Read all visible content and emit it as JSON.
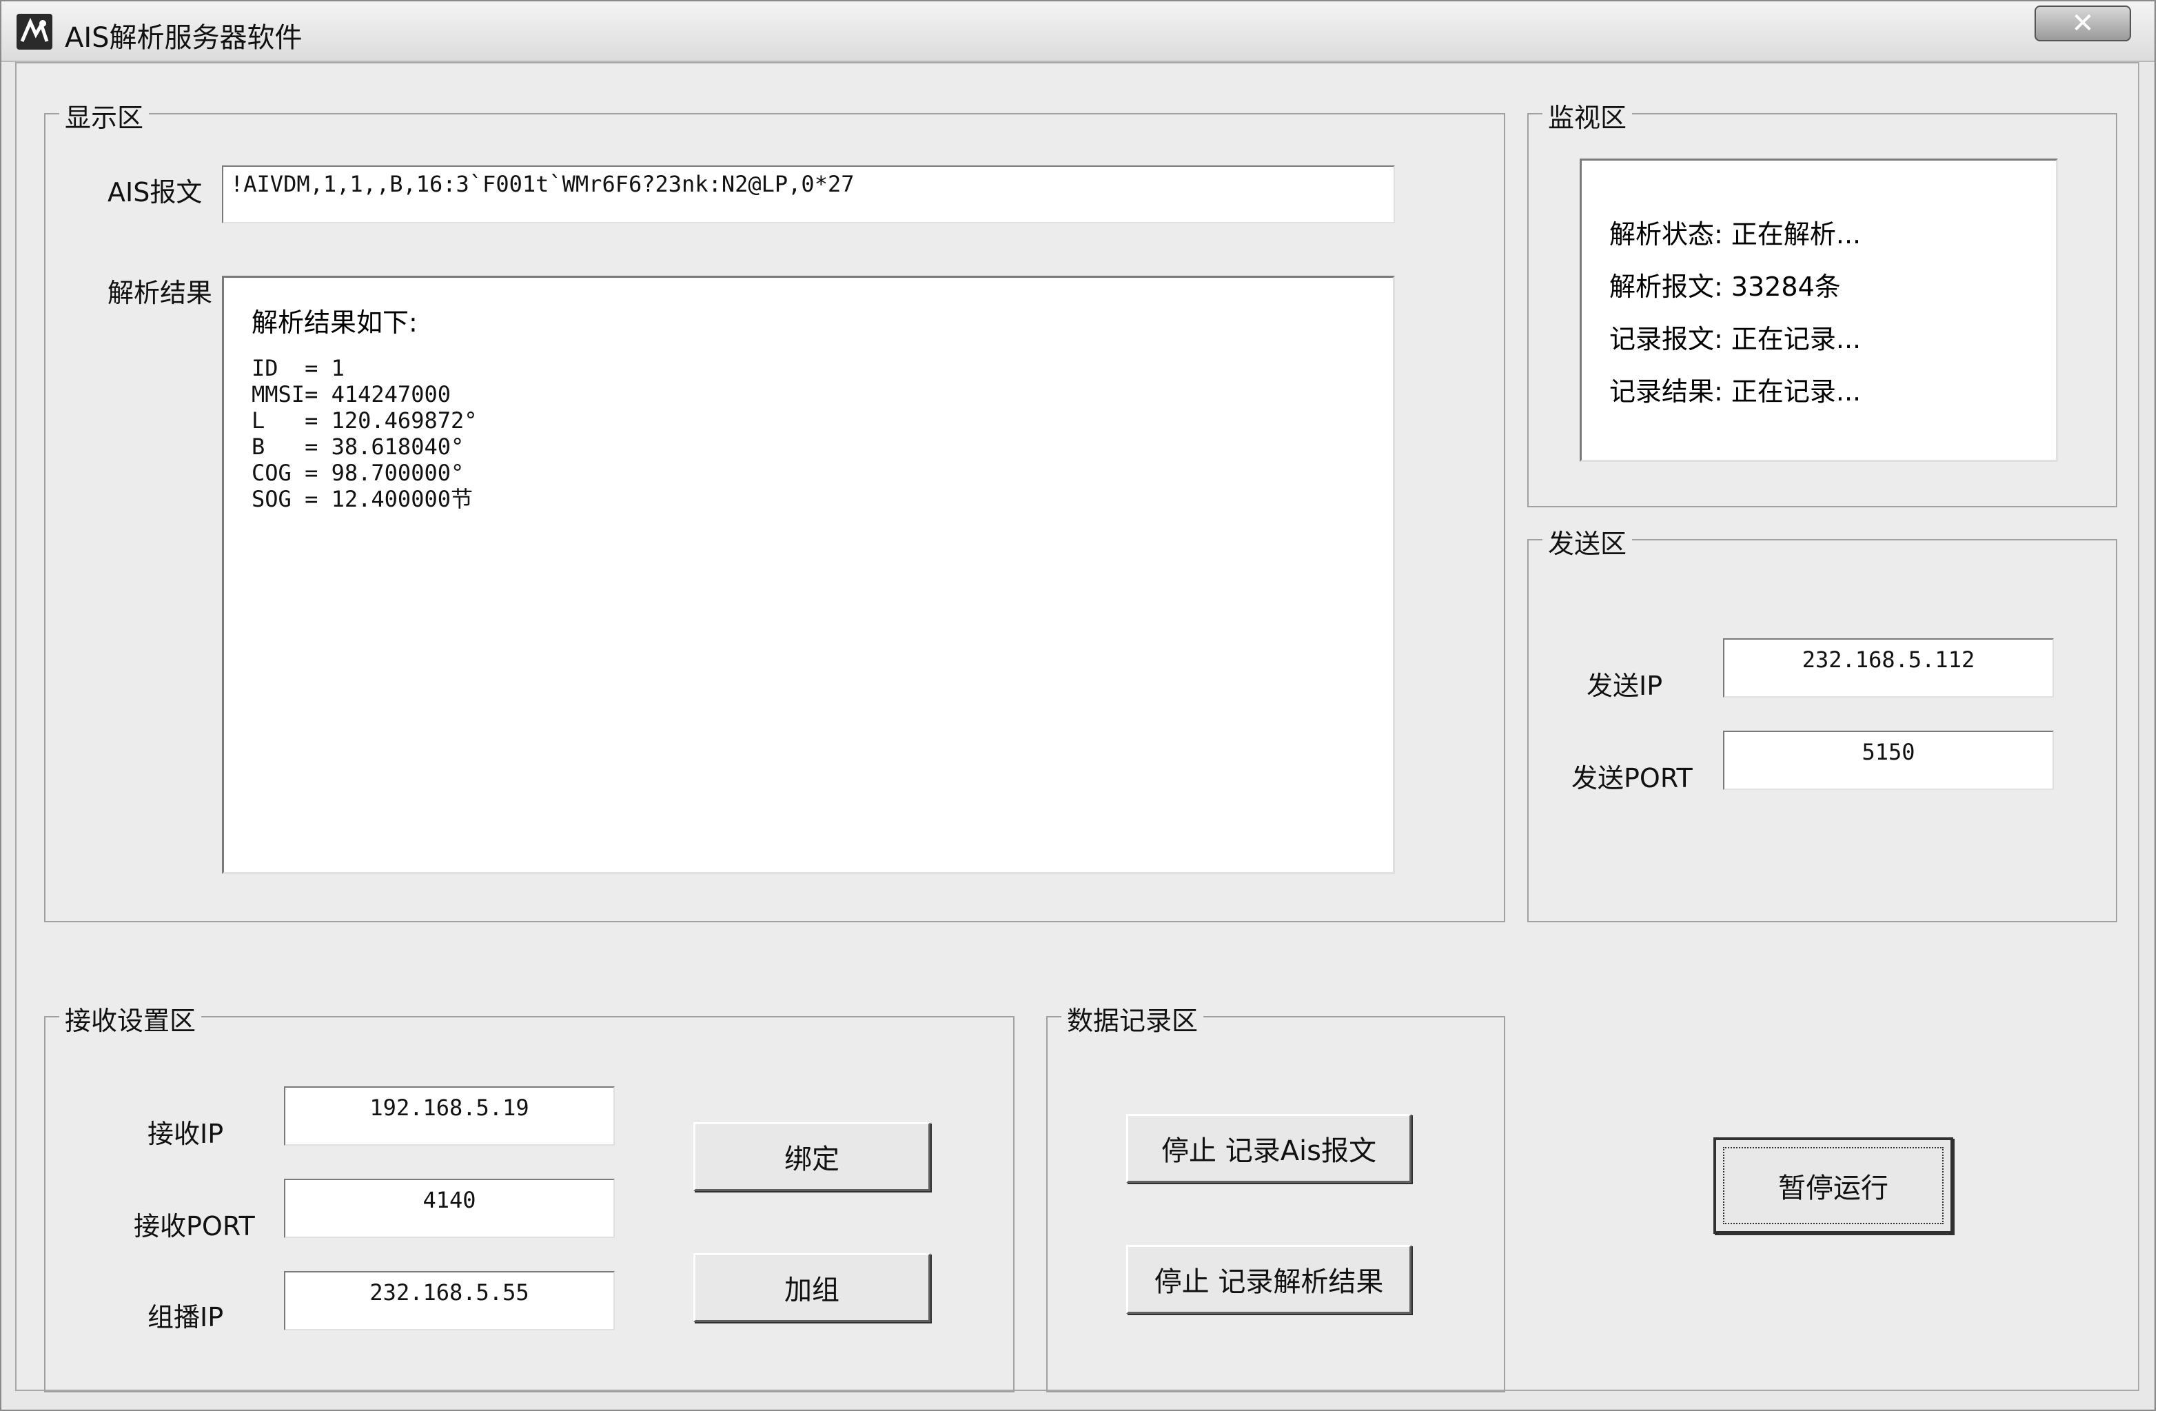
{
  "window": {
    "title": "AIS解析服务器软件",
    "close_label": "✕"
  },
  "display": {
    "legend": "显示区",
    "ais_label": "AIS报文",
    "ais_value": "!AIVDM,1,1,,B,16:3`F001t`WMr6F6?23nk:N2@LP,0*27",
    "result_label": "解析结果",
    "result_heading": "解析结果如下:",
    "result_lines": [
      "ID  = 1",
      "MMSI= 414247000",
      "L   = 120.469872°",
      "B   = 38.618040°",
      "COG = 98.700000°",
      "SOG = 12.400000节"
    ]
  },
  "monitor": {
    "legend": "监视区",
    "lines": [
      "解析状态: 正在解析...",
      "解析报文:  33284条",
      "记录报文: 正在记录...",
      "记录结果: 正在记录..."
    ]
  },
  "send": {
    "legend": "发送区",
    "ip_label": "发送IP",
    "ip_value": "232.168.5.112",
    "port_label": "发送PORT",
    "port_value": "5150"
  },
  "receive": {
    "legend": "接收设置区",
    "ip_label": "接收IP",
    "ip_value": "192.168.5.19",
    "port_label": "接收PORT",
    "port_value": "4140",
    "multicast_label": "组播IP",
    "multicast_value": "232.168.5.55",
    "bind_button": "绑定",
    "join_button": "加组"
  },
  "record": {
    "legend": "数据记录区",
    "stop_ais_button": "停止 记录Ais报文",
    "stop_result_button": "停止 记录解析结果"
  },
  "pause_button": "暂停运行"
}
